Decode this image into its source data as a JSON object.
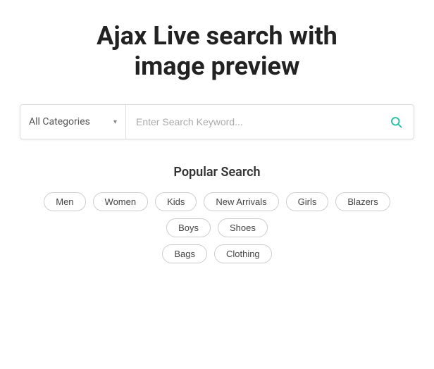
{
  "header": {
    "title_line1": "Ajax Live search with",
    "title_line2": "image preview",
    "full_title": "Ajax Live search with image preview"
  },
  "search_bar": {
    "category_default": "All Categories",
    "search_placeholder": "Enter Search Keyword...",
    "search_value": ""
  },
  "popular_search": {
    "section_title": "Popular Search",
    "tags_row1": [
      "Men",
      "Women",
      "Kids",
      "New Arrivals",
      "Girls",
      "Blazers",
      "Boys",
      "Shoes"
    ],
    "tags_row2": [
      "Bags",
      "Clothing"
    ]
  },
  "icons": {
    "chevron": "▾",
    "search": "🔍"
  }
}
